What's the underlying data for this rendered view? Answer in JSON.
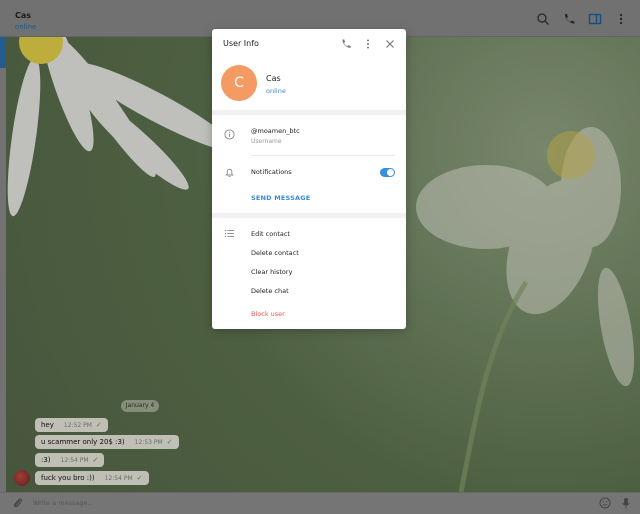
{
  "chat": {
    "name": "Cas",
    "status": "online",
    "composer_placeholder": "Write a message..."
  },
  "messages": {
    "date_pill": "January 4",
    "items": [
      {
        "text": "hey",
        "time": "12:52 PM"
      },
      {
        "text": "u scammer only 20$ :3)",
        "time": "12:53 PM"
      },
      {
        "text": ":3)",
        "time": "12:54 PM"
      },
      {
        "text": "fuck you bro :))",
        "time": "12:54 PM"
      }
    ]
  },
  "modal": {
    "title": "User Info",
    "avatar_letter": "C",
    "avatar_color": "#f49a63",
    "name": "Cas",
    "status": "online",
    "username": "@moamen_btc",
    "username_label": "Username",
    "notifications_label": "Notifications",
    "notifications_on": true,
    "send_message": "SEND MESSAGE",
    "actions": {
      "edit": "Edit contact",
      "delete_contact": "Delete contact",
      "clear_history": "Clear history",
      "delete_chat": "Delete chat",
      "block": "Block user"
    }
  },
  "colors": {
    "accent": "#3a8ad0",
    "danger": "#e05a4f"
  }
}
